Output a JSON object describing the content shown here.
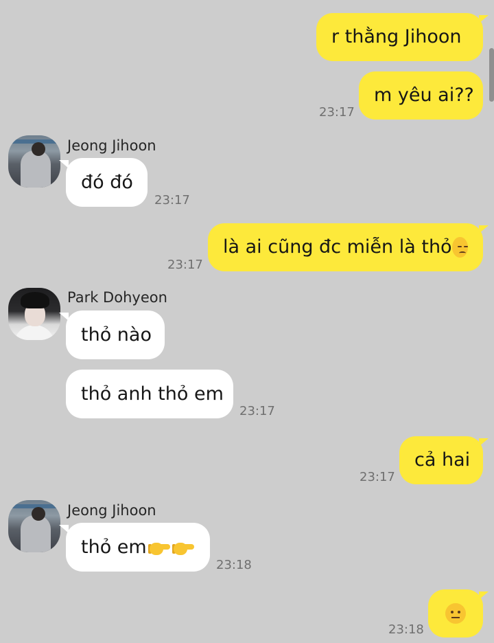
{
  "messages": {
    "m1": {
      "text": "r thằng Jihoon"
    },
    "m2": {
      "text": "m yêu ai??",
      "time": "23:17"
    },
    "m3": {
      "sender": "Jeong Jihoon",
      "text": "đó đó",
      "time": "23:17"
    },
    "m4": {
      "text": "là ai cũng đc miễn là thỏ",
      "emoji": "pensive-face",
      "time": "23:17"
    },
    "m5": {
      "sender": "Park Dohyeon",
      "text": "thỏ nào"
    },
    "m6": {
      "text": "thỏ anh thỏ em",
      "time": "23:17"
    },
    "m7": {
      "text": "cả hai",
      "time": "23:17"
    },
    "m8": {
      "sender": "Jeong Jihoon",
      "text": "thỏ em",
      "emoji": "point-right-x2",
      "time": "23:18"
    },
    "m9": {
      "emoji": "neutral-face",
      "time": "23:18"
    }
  },
  "colors": {
    "background": "#cdcdcd",
    "outgoing_bubble": "#fde93b",
    "incoming_bubble": "#ffffff",
    "timestamp": "#6f6f6f"
  }
}
